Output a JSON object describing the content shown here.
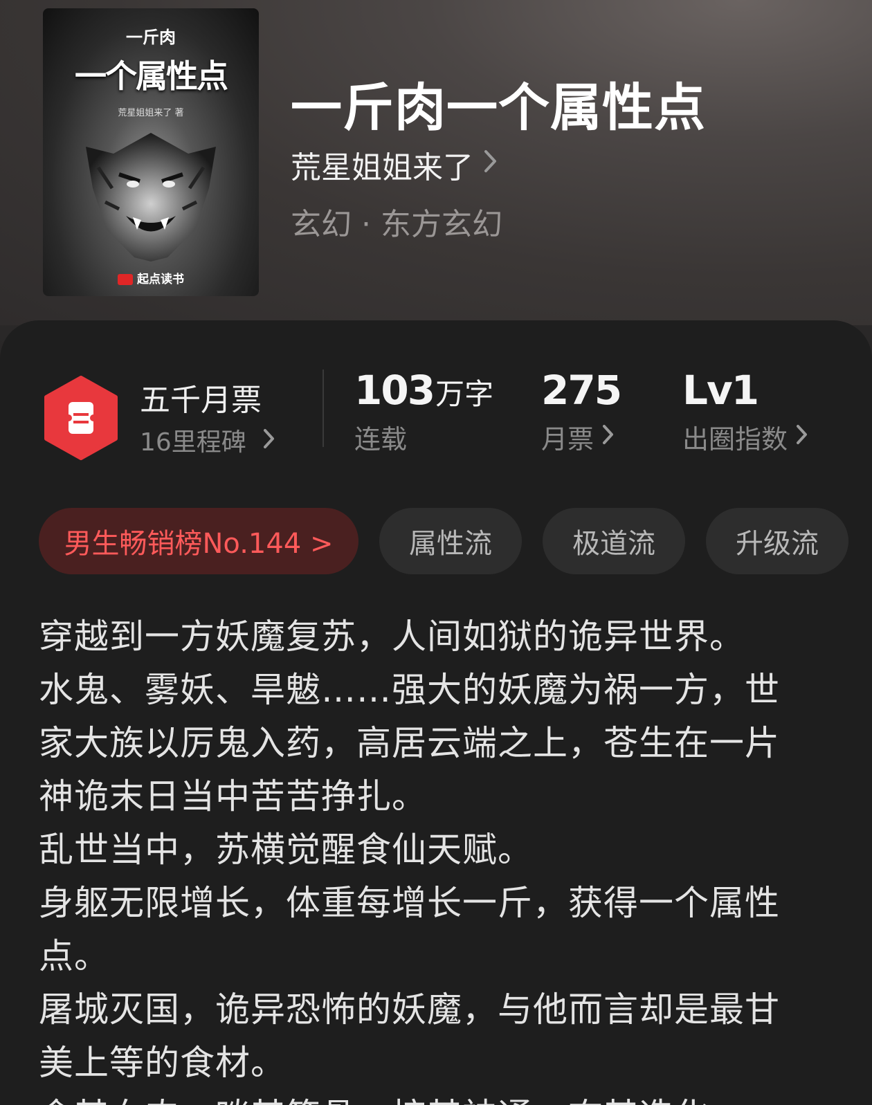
{
  "book": {
    "cover": {
      "author_top": "一斤肉",
      "title": "一个属性点",
      "subtitle": "荒星姐姐来了 著",
      "brand": "起点读书",
      "brand_icon": "qidian-logo-icon"
    },
    "title": "一斤肉一个属性点",
    "author": "荒星姐姐来了",
    "genre": "玄幻 · 东方玄幻"
  },
  "stats": {
    "ticket_title": "五千月票",
    "ticket_sub": "16里程碑",
    "ticket_icon": "ticket-hexagon-icon",
    "words_num": "103",
    "words_unit": "万字",
    "words_label": "连载",
    "monthly_num": "275",
    "monthly_label": "月票",
    "index_num": "Lv1",
    "index_label": "出圈指数"
  },
  "tags": {
    "rank": "男生畅销榜No.144 >",
    "tag1": "属性流",
    "tag2": "极道流",
    "tag3": "升级流"
  },
  "description": [
    "穿越到一方妖魔复苏，人间如狱的诡异世界。",
    "水鬼、雾妖、旱魃……强大的妖魔为祸一方，世",
    "家大族以厉鬼入药，高居云端之上，苍生在一片",
    "神诡末日当中苦苦挣扎。",
    "乱世当中，苏横觉醒食仙天赋。",
    "身躯无限增长，体重每增长一斤，获得一个属性点。",
    "屠城灭国，诡异恐怖的妖魔，与他而言却是最甘",
    "美上等的食材。",
    "食其血肉，啖其筋骨；掠其神通，夺其造化。"
  ],
  "colors": {
    "accent_red": "#e8383d",
    "rank_text": "#ff5a5a",
    "rank_bg": "#4a2020"
  }
}
